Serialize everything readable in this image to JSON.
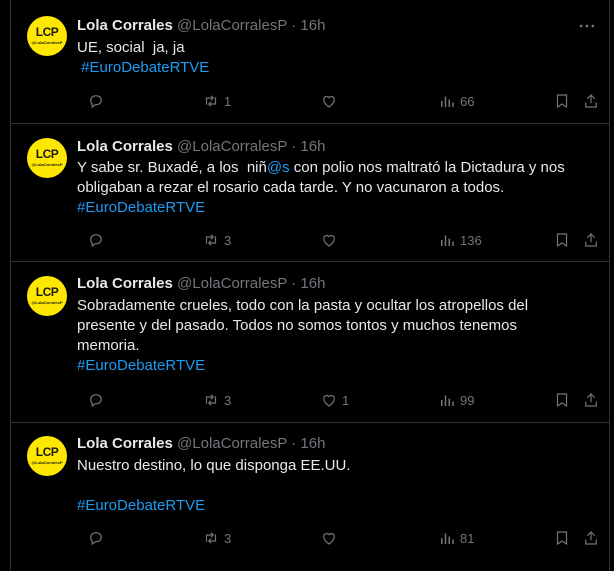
{
  "tweets": [
    {
      "avatar_text": "LCP",
      "avatar_sub": "@LolaCorralesP",
      "name": "Lola Corrales",
      "handle": "@LolaCorralesP",
      "time": "16h",
      "line1": "UE, social  ja, ja",
      "hashtag": " #EuroDebateRTVE",
      "reply_count": "",
      "retweet_count": "1",
      "like_count": "",
      "view_count": "66"
    },
    {
      "avatar_text": "LCP",
      "avatar_sub": "@LolaCorralesP",
      "name": "Lola Corrales",
      "handle": "@LolaCorralesP",
      "time": "16h",
      "line1_a": "Y sabe sr. Buxadé, a los  niñ",
      "line1_mention": "@s",
      "line1_b": " con polio nos maltrató la Dictadura y nos",
      "line2": "obligaban a rezar el rosario cada tarde. Y no vacunaron a todos.",
      "hashtag": "#EuroDebateRTVE",
      "reply_count": "",
      "retweet_count": "3",
      "like_count": "",
      "view_count": "136"
    },
    {
      "avatar_text": "LCP",
      "avatar_sub": "@LolaCorralesP",
      "name": "Lola Corrales",
      "handle": "@LolaCorralesP",
      "time": "16h",
      "line1": "Sobradamente crueles, todo con la pasta y ocultar los atropellos del",
      "line2": "presente y del pasado. Todos no somos tontos y muchos tenemos",
      "line3": "memoria.",
      "hashtag": "#EuroDebateRTVE",
      "reply_count": "",
      "retweet_count": "3",
      "like_count": "1",
      "view_count": "99"
    },
    {
      "avatar_text": "LCP",
      "avatar_sub": "@LolaCorralesP",
      "name": "Lola Corrales",
      "handle": "@LolaCorralesP",
      "time": "16h",
      "line1": "Nuestro destino, lo que disponga EE.UU.",
      "hashtag": "#EuroDebateRTVE",
      "reply_count": "",
      "retweet_count": "3",
      "like_count": "",
      "view_count": "81"
    }
  ],
  "icons": {
    "more": "more-dots-icon",
    "reply": "reply-icon",
    "retweet": "retweet-icon",
    "like": "heart-icon",
    "views": "views-icon",
    "bookmark": "bookmark-icon",
    "share": "share-icon"
  },
  "colors": {
    "background": "#000000",
    "text": "#e7e9ea",
    "muted": "#71767b",
    "link": "#1d9bf0",
    "avatar": "#ffe800",
    "divider": "#2f3336"
  }
}
